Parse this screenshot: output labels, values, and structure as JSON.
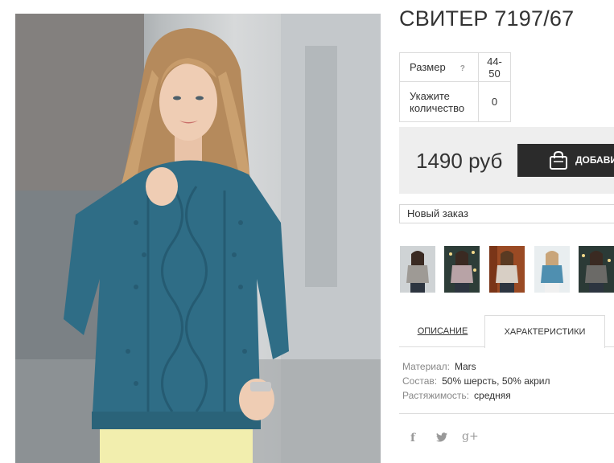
{
  "product": {
    "title": "СВИТЕР 7197/67",
    "photo_alt": "Девушка в синем вязаном свитере"
  },
  "specs": {
    "size_label": "Размер",
    "size_help": "?",
    "size_value": "44-50",
    "qty_label": "Укажите количество",
    "qty_value": "0"
  },
  "buy": {
    "price": "1490 руб",
    "add_label": "ДОБАВИТЬ",
    "bag_icon": "shopping-bag-icon"
  },
  "order_select": {
    "value": "Новый заказ"
  },
  "thumbnails": [
    {
      "name": "thumb-grey-sweater",
      "color": "#9e9a95"
    },
    {
      "name": "thumb-pink-sweater",
      "color": "#b8a3a6"
    },
    {
      "name": "thumb-beige-sweater",
      "color": "#d8cfc5"
    },
    {
      "name": "thumb-blue-sweater",
      "color": "#4f8fb0"
    },
    {
      "name": "thumb-dark-grey-sweater",
      "color": "#6b6a67"
    }
  ],
  "tabs": {
    "description": "ОПИСАНИЕ",
    "characteristics": "ХАРАКТЕРИСТИКИ"
  },
  "characteristics": {
    "material_label": "Материал:",
    "material_value": "Mars",
    "composition_label": "Состав:",
    "composition_value": "50% шерсть, 50% акрил",
    "stretch_label": "Растяжимость:",
    "stretch_value": "средняя"
  },
  "social": {
    "facebook": "f",
    "twitter": "twitter-icon",
    "google_plus": "g+"
  },
  "colors": {
    "button_bg": "#2b2b2b",
    "buybox_bg": "#eeeeee",
    "sweater": "#2f6d86"
  }
}
